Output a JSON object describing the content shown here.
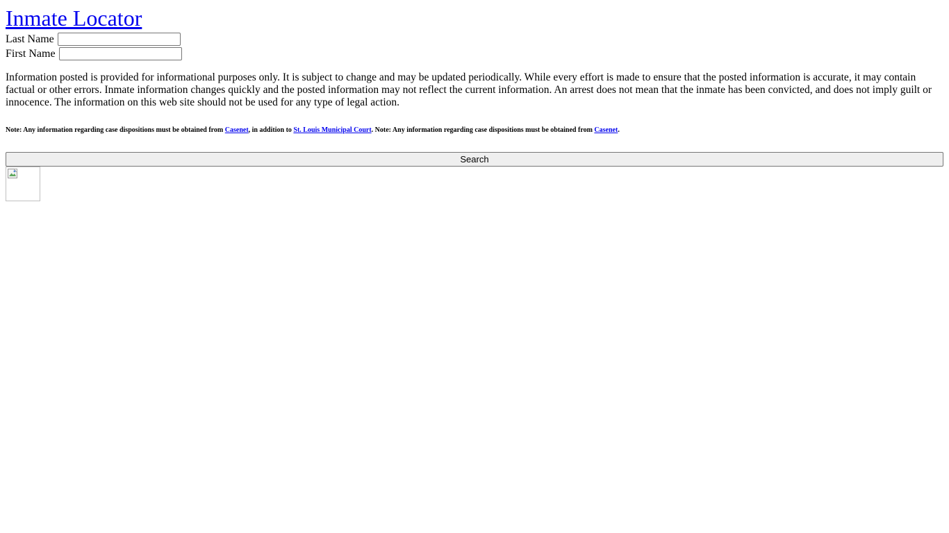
{
  "header": {
    "title": "Inmate Locator"
  },
  "form": {
    "last_name_label": "Last Name",
    "last_name_value": "",
    "first_name_label": "First Name",
    "first_name_value": "",
    "search_label": "Search"
  },
  "disclaimer": {
    "text": "Information posted is provided for informational purposes only. It is subject to change and may be updated periodically. While every effort is made to ensure that the posted information is accurate, it may contain factual or other errors. Inmate information changes quickly and the posted information may not reflect the current information. An arrest does not mean that the inmate has been convicted, and does not imply guilt or innocence. The information on this web site should not be used for any type of legal action."
  },
  "note": {
    "prefix": "Note: Any information regarding case dispositions must be obtained from ",
    "link1": "Casenet",
    "middle": ", in addition to ",
    "link2": "St. Louis Municipal Court",
    "middle2": ". Note: Any information regarding case dispositions must be obtained from ",
    "link3": "Casenet",
    "suffix": "."
  },
  "colors": {
    "link": "#0000ee",
    "button_bg": "#efefef",
    "border": "#767676"
  },
  "icons": {
    "image_placeholder": "broken-image-icon"
  }
}
